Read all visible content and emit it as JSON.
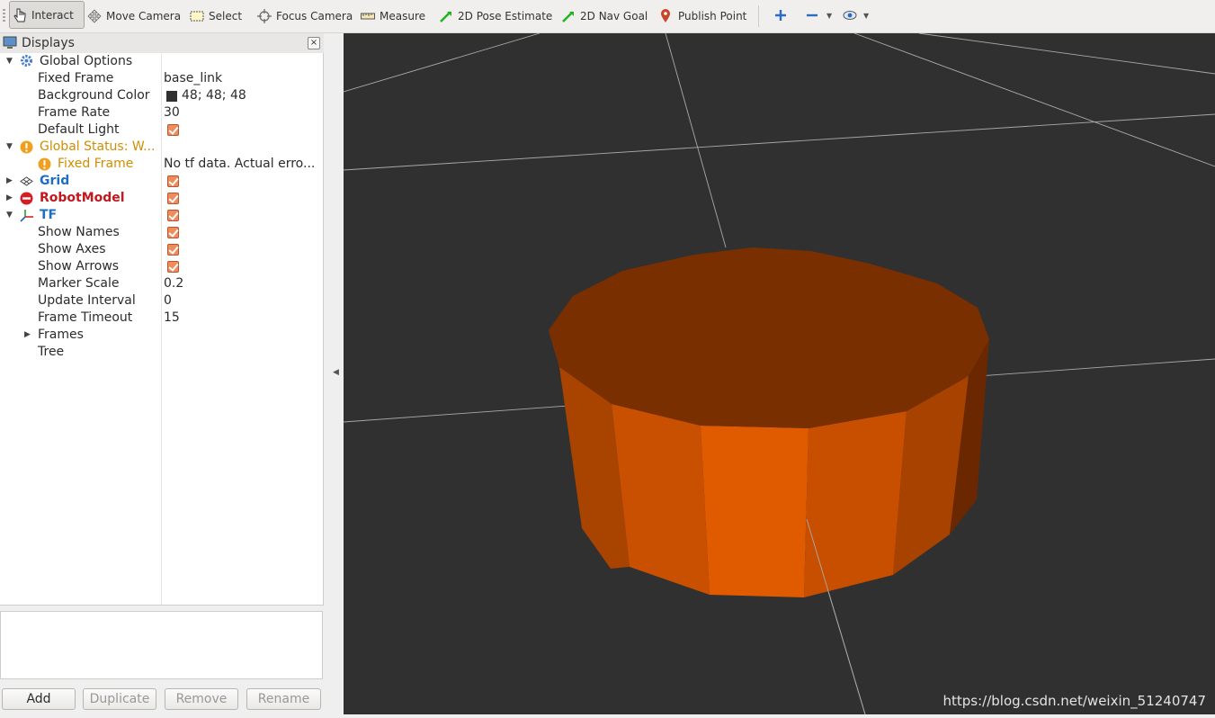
{
  "toolbar": {
    "interact": "Interact",
    "move_camera": "Move Camera",
    "select": "Select",
    "focus_camera": "Focus Camera",
    "measure": "Measure",
    "pose_estimate": "2D Pose Estimate",
    "nav_goal": "2D Nav Goal",
    "publish_point": "Publish Point"
  },
  "displays": {
    "title": "Displays",
    "close": "×",
    "rows": [
      {
        "label": "Global Options",
        "value": ""
      },
      {
        "label": "Fixed Frame",
        "value": "base_link"
      },
      {
        "label": "Background Color",
        "value": "48; 48; 48"
      },
      {
        "label": "Frame Rate",
        "value": "30"
      },
      {
        "label": "Default Light",
        "value": ""
      },
      {
        "label": "Global Status: W...",
        "value": ""
      },
      {
        "label": "Fixed Frame",
        "value": "No tf data.  Actual erro..."
      },
      {
        "label": "Grid",
        "value": ""
      },
      {
        "label": "RobotModel",
        "value": ""
      },
      {
        "label": "TF",
        "value": ""
      },
      {
        "label": "Show Names",
        "value": ""
      },
      {
        "label": "Show Axes",
        "value": ""
      },
      {
        "label": "Show Arrows",
        "value": ""
      },
      {
        "label": "Marker Scale",
        "value": "0.2"
      },
      {
        "label": "Update Interval",
        "value": "0"
      },
      {
        "label": "Frame Timeout",
        "value": "15"
      },
      {
        "label": "Frames",
        "value": ""
      },
      {
        "label": "Tree",
        "value": ""
      }
    ],
    "buttons": {
      "add": "Add",
      "duplicate": "Duplicate",
      "remove": "Remove",
      "rename": "Rename"
    }
  },
  "colors": {
    "background": "#303030",
    "warning": "#d18d00",
    "link": "#1e6fc4",
    "error": "#c2191f",
    "cylinder_top": "#7a2f00",
    "cylinder_front": "#e05a00"
  },
  "viewport": {
    "watermark": "https://blog.csdn.net/weixin_51240747"
  }
}
